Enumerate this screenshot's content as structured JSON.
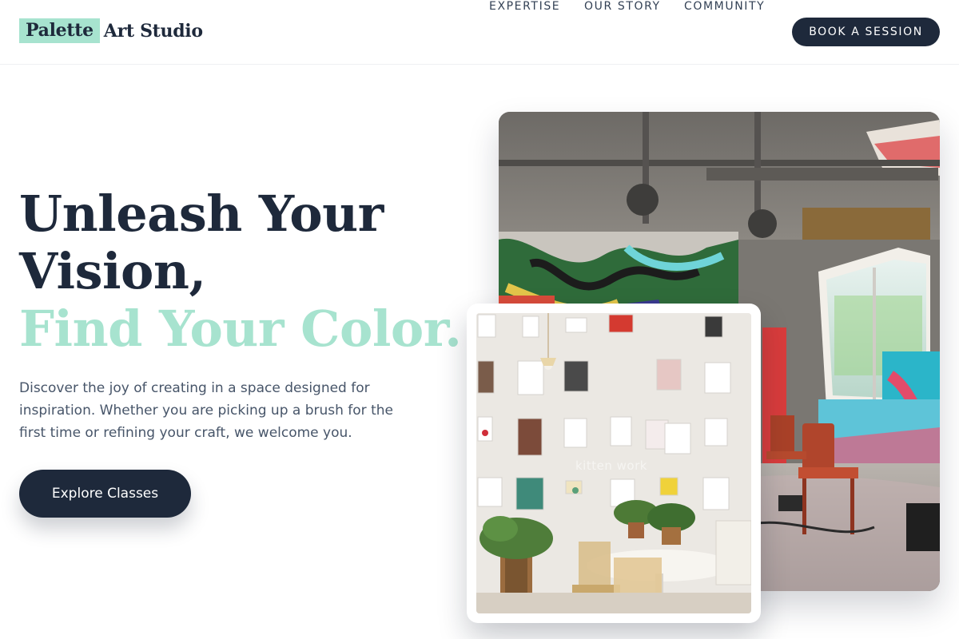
{
  "header": {
    "logo_mark": "Palette",
    "logo_rest": "Art Studio",
    "nav": [
      "EXPERTISE",
      "OUR STORY",
      "COMMUNITY"
    ],
    "cta": "BOOK A SESSION"
  },
  "hero": {
    "headline_line1": "Unleash Your",
    "headline_line2": "Vision,",
    "headline_accent": "Find Your Color.",
    "description": "Discover the joy of creating in a space designed for inspiration. Whether you are picking up a brush for the first time or refining your craft, we welcome you.",
    "button": "Explore Classes"
  },
  "images": {
    "gallery_watermark": "kitten work"
  },
  "colors": {
    "navy": "#1e293b",
    "mint": "#a7e3cf",
    "body_text": "#475569"
  }
}
